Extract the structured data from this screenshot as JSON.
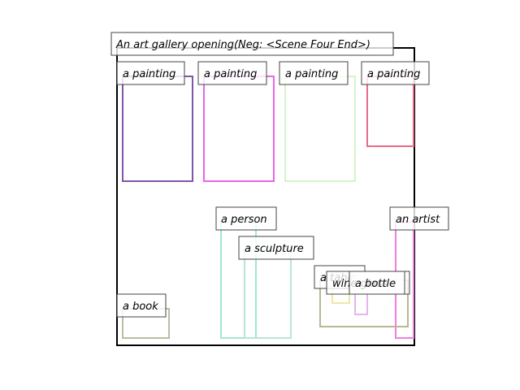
{
  "scene": {
    "caption": "An art gallery opening(Neg: <Scene Four End>)",
    "frame_color": "#000000"
  },
  "objects": [
    {
      "id": "painting-1",
      "label": "a painting",
      "color": "#8057a8"
    },
    {
      "id": "painting-2",
      "label": "a painting",
      "color": "#e865e8"
    },
    {
      "id": "painting-3",
      "label": "a painting",
      "color": "#d4f5c8"
    },
    {
      "id": "painting-4",
      "label": "a painting",
      "color": "#e86a8a"
    },
    {
      "id": "person",
      "label": "a person",
      "color": "#9fe8cf"
    },
    {
      "id": "sculpture",
      "label": "a sculpture",
      "color": "#b8e6d2"
    },
    {
      "id": "artist",
      "label": "an artist",
      "color": "#ee80e0"
    },
    {
      "id": "table",
      "label": "a table",
      "color": "#b8b894"
    },
    {
      "id": "wine-glass",
      "label": "wine glass",
      "color": "#f0e6a8"
    },
    {
      "id": "bottle",
      "label": "a bottle",
      "color": "#e6b4ee"
    },
    {
      "id": "book",
      "label": "a book",
      "color": "#bcbca4"
    }
  ]
}
